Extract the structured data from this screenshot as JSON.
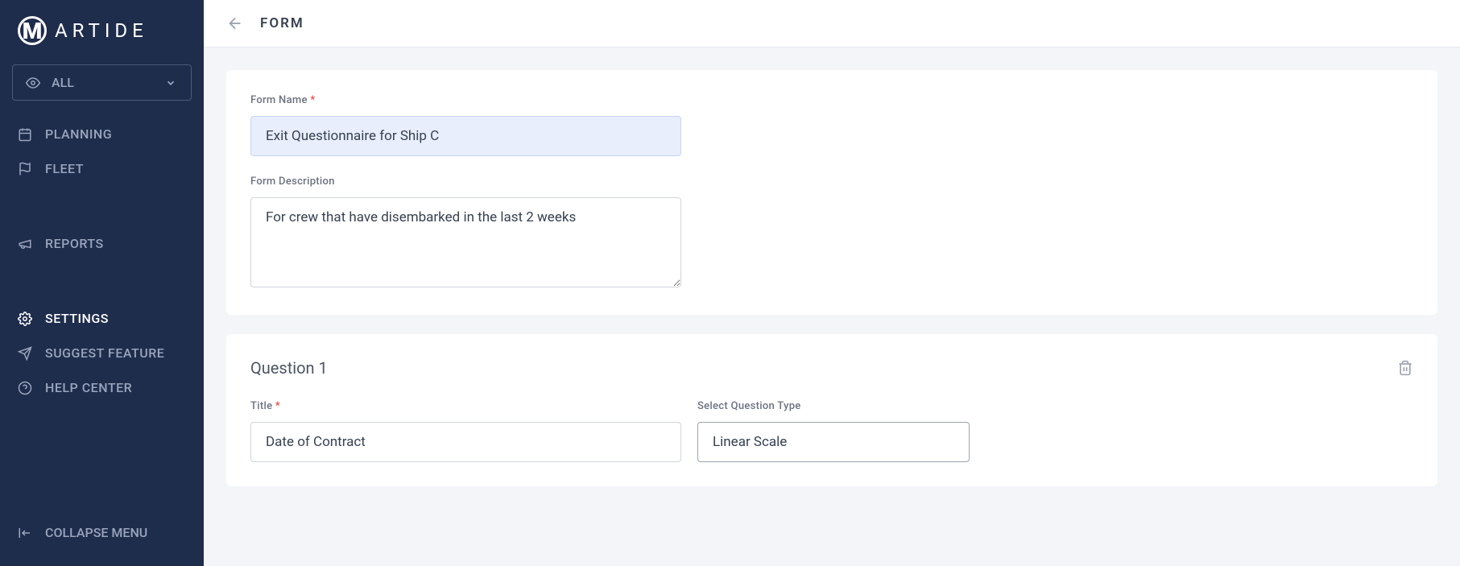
{
  "brand": {
    "logo_letter": "M",
    "logo_text": "ARTIDE"
  },
  "sidebar": {
    "all_selector": "ALL",
    "items": [
      {
        "label": "PLANNING",
        "icon": "calendar"
      },
      {
        "label": "FLEET",
        "icon": "flag"
      }
    ],
    "items2": [
      {
        "label": "REPORTS",
        "icon": "megaphone"
      }
    ],
    "items3": [
      {
        "label": "SETTINGS",
        "icon": "gear",
        "active": true
      },
      {
        "label": "SUGGEST FEATURE",
        "icon": "send"
      },
      {
        "label": "HELP CENTER",
        "icon": "help"
      }
    ],
    "collapse_label": "COLLAPSE MENU"
  },
  "header": {
    "title": "FORM"
  },
  "form": {
    "name_label": "Form Name",
    "name_value": "Exit Questionnaire for Ship C",
    "description_label": "Form Description",
    "description_value": "For crew that have disembarked in the last 2 weeks"
  },
  "question": {
    "heading": "Question 1",
    "title_label": "Title",
    "title_value": "Date of Contract",
    "type_label": "Select Question Type",
    "type_value": "Linear Scale"
  }
}
